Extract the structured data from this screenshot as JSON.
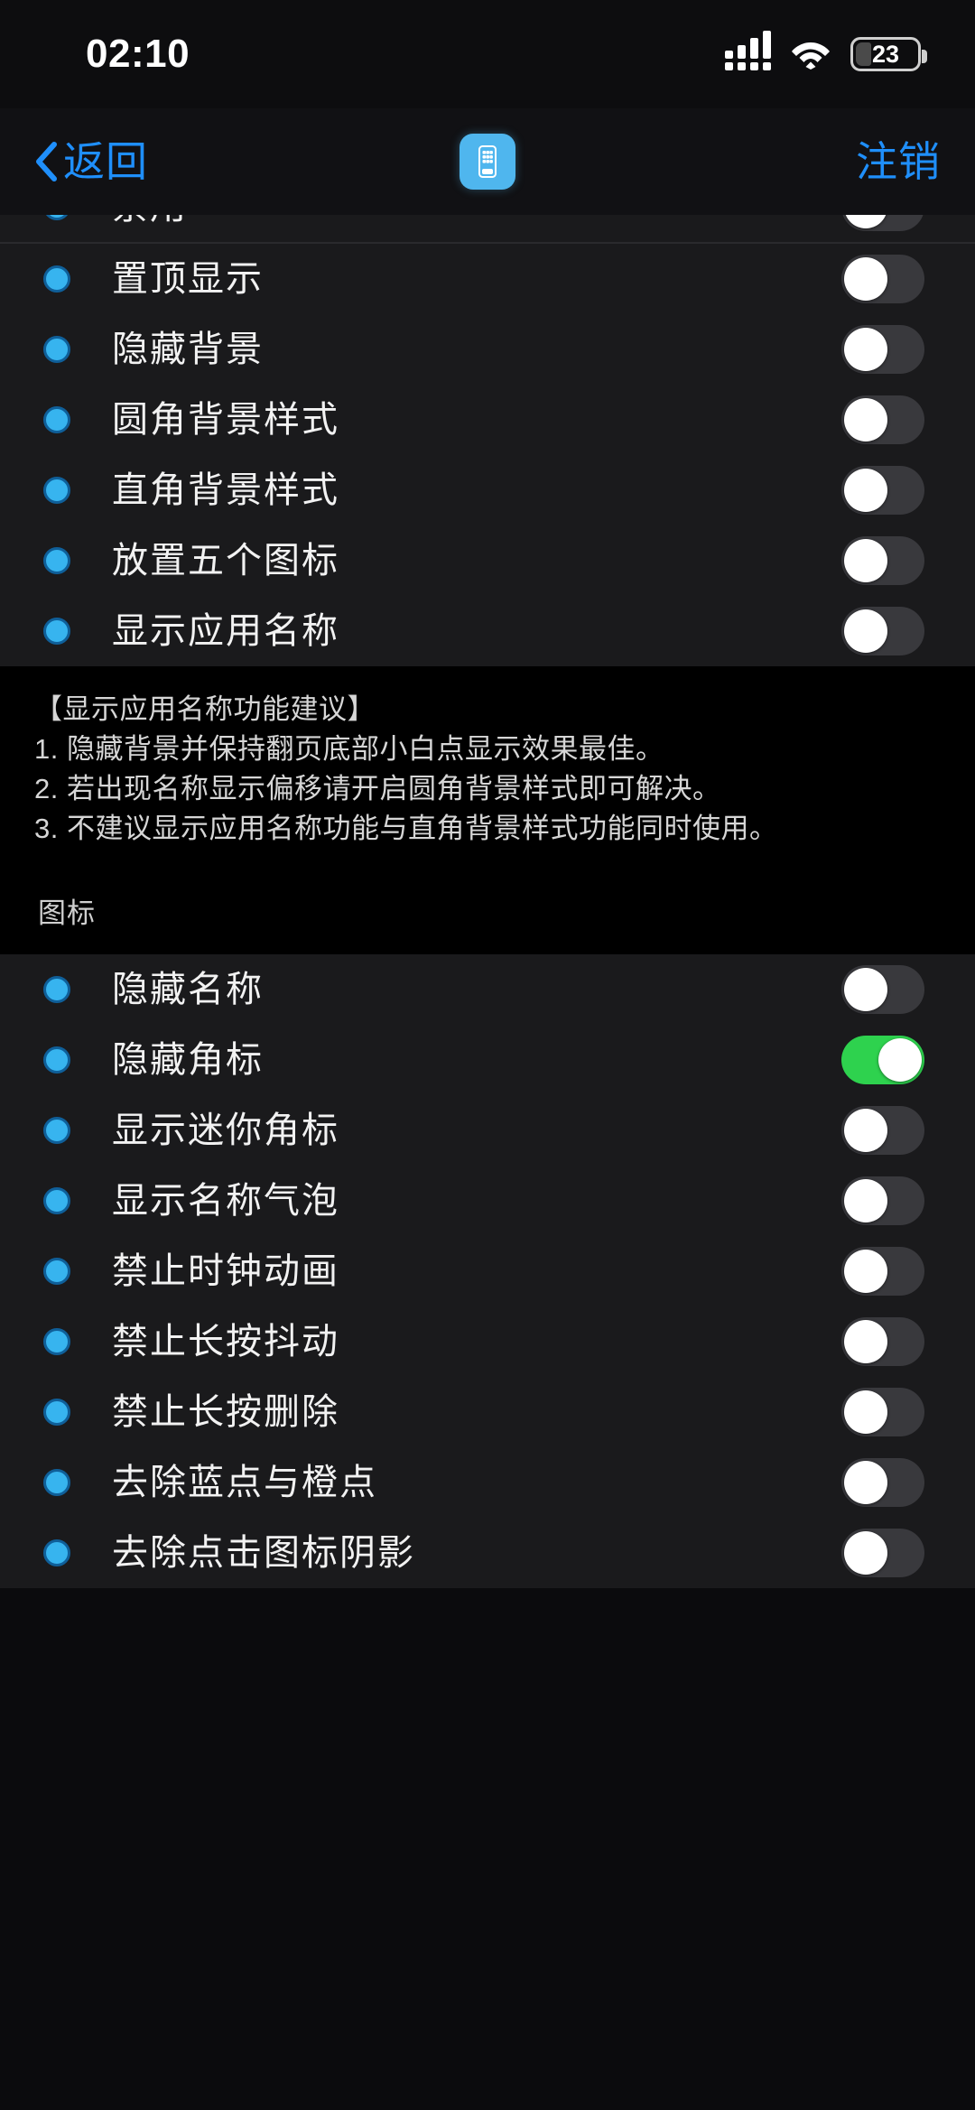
{
  "status_bar": {
    "time": "02:10",
    "battery_percent": "23",
    "signal_icon": "cellular-signal-icon",
    "wifi_icon": "wifi-icon",
    "battery_icon": "battery-icon"
  },
  "nav_bar": {
    "back_label": "返回",
    "back_icon": "chevron-left-icon",
    "app_icon": "springboard-app-icon",
    "logout_label": "注销",
    "accent_color": "#1f8ffb"
  },
  "sections": [
    {
      "name": "display-group",
      "header": "",
      "clipped_first_row": {
        "label": "禁用",
        "enabled": false
      },
      "rows": [
        {
          "label": "置顶显示",
          "enabled": false
        },
        {
          "label": "隐藏背景",
          "enabled": false
        },
        {
          "label": "圆角背景样式",
          "enabled": false
        },
        {
          "label": "直角背景样式",
          "enabled": false
        },
        {
          "label": "放置五个图标",
          "enabled": false
        },
        {
          "label": "显示应用名称",
          "enabled": false
        }
      ],
      "footer_lines": [
        "【显示应用名称功能建议】",
        "1. 隐藏背景并保持翻页底部小白点显示效果最佳。",
        "2. 若出现名称显示偏移请开启圆角背景样式即可解决。",
        "3. 不建议显示应用名称功能与直角背景样式功能同时使用。"
      ]
    },
    {
      "name": "icon-group",
      "header": "图标",
      "rows": [
        {
          "label": "隐藏名称",
          "enabled": false
        },
        {
          "label": "隐藏角标",
          "enabled": true
        },
        {
          "label": "显示迷你角标",
          "enabled": false
        },
        {
          "label": "显示名称气泡",
          "enabled": false
        },
        {
          "label": "禁止时钟动画",
          "enabled": false
        },
        {
          "label": "禁止长按抖动",
          "enabled": false
        },
        {
          "label": "禁止长按删除",
          "enabled": false
        },
        {
          "label": "去除蓝点与橙点",
          "enabled": false
        },
        {
          "label": "去除点击图标阴影",
          "enabled": false
        }
      ]
    }
  ],
  "colors": {
    "background": "#000000",
    "group_background": "#1a1a1c",
    "accent_blue": "#1f8ffb",
    "bullet_blue": "#37b4ef",
    "switch_on_green": "#2ed24e",
    "switch_off_gray": "#39393d",
    "text_primary": "#f2f2f2",
    "text_secondary": "#d6d6d6"
  }
}
